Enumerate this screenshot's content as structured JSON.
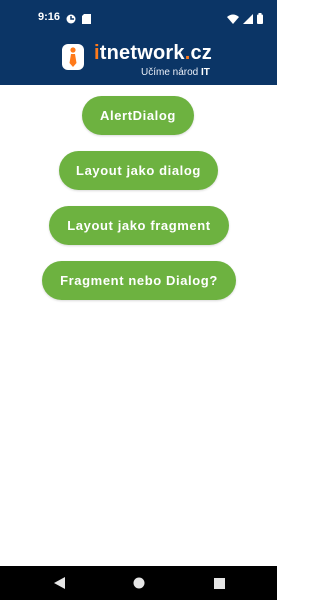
{
  "status_bar": {
    "time": "9:16",
    "left_icons": [
      "app-notification-icon",
      "sd-card-icon"
    ],
    "right_icons": [
      "wifi-icon",
      "cell-signal-icon",
      "battery-icon"
    ]
  },
  "header": {
    "brand_i": "i",
    "brand_name": "tnetwork",
    "brand_dot": ".",
    "brand_tld": "cz",
    "tagline": "Učíme národ",
    "tagline_bold": "IT",
    "background": "#0b3566",
    "accent": "#ff7a1a"
  },
  "buttons": {
    "alert_dialog": "AlertDialog",
    "layout_dialog": "Layout jako dialog",
    "layout_fragment": "Layout jako fragment",
    "fragment_or_dialog": "Fragment nebo Dialog?",
    "color": "#6db240"
  },
  "nav": {
    "icons": [
      "back-icon",
      "home-icon",
      "recents-icon"
    ]
  }
}
